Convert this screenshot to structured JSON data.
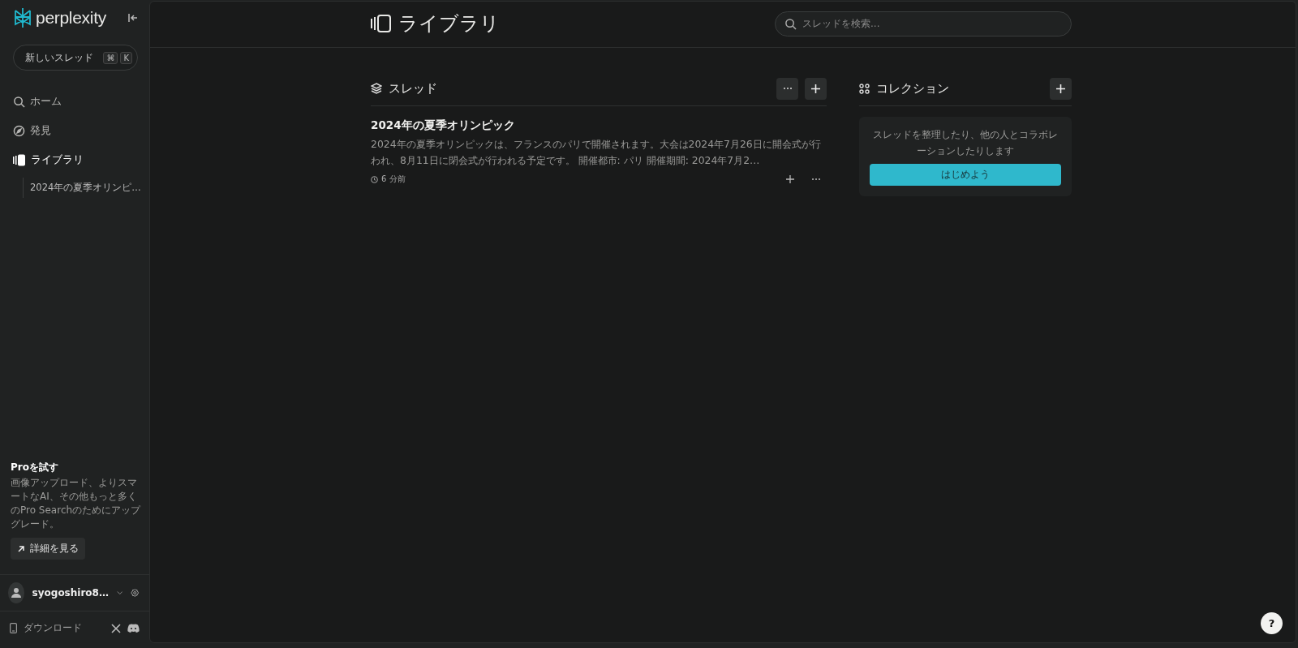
{
  "sidebar": {
    "logo": "perplexity",
    "new_thread": {
      "label": "新しいスレッド",
      "keys": [
        "⌘",
        "K"
      ]
    },
    "nav": [
      {
        "label": "ホーム",
        "selected": false
      },
      {
        "label": "発見",
        "selected": false
      },
      {
        "label": "ライブラリ",
        "selected": true
      }
    ],
    "recent": [
      "2024年の夏季オリンピ…"
    ],
    "pro": {
      "title": "Proを試す",
      "text": "画像アップロード、よりスマートなAI、その他もっと多くのPro Searchのためにアップグレード。",
      "button": "詳細を見る"
    },
    "user": {
      "name": "syogoshiro8…"
    },
    "download": "ダウンロード"
  },
  "header": {
    "title": "ライブラリ",
    "search": {
      "placeholder": "スレッドを検索..."
    }
  },
  "threads": {
    "title": "スレッド",
    "items": [
      {
        "title": "2024年の夏季オリンピック",
        "snippet": "2024年の夏季オリンピックは、フランスのパリで開催されます。大会は2024年7月26日に開会式が行われ、8月11日に閉会式が行われる予定です。 開催都市: パリ 開催期間: 2024年7月2…",
        "time": "6 分前"
      }
    ]
  },
  "collections": {
    "title": "コレクション",
    "empty_text": "スレッドを整理したり、他の人とコラボレーションしたりします",
    "button": "はじめよう"
  },
  "help": "?"
}
